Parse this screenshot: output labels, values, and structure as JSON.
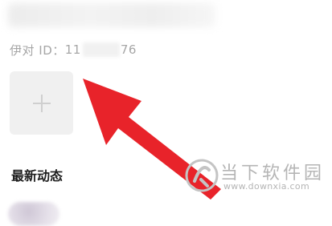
{
  "profile": {
    "id_label": "伊对 ID：",
    "id_prefix": "11",
    "id_suffix": "76"
  },
  "photos": {
    "add_symbol": "+"
  },
  "feed": {
    "section_title": "最新动态"
  },
  "watermark": {
    "title": "当下软件园",
    "url": "www.downxia.com"
  },
  "colors": {
    "arrow": "#e8232a",
    "tile": "#f0f0f0",
    "muted_text": "#a6a6a6"
  },
  "icons": {
    "add": "plus-icon",
    "annotation": "red-arrow"
  }
}
